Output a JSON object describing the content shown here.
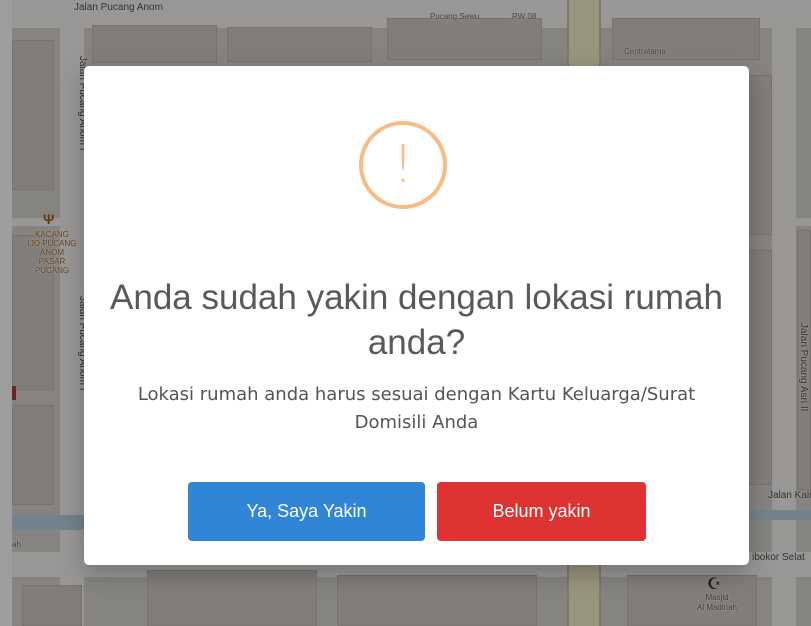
{
  "map": {
    "labels": {
      "jalan_pucang_anom_top": "Jalan Pucang Anom",
      "jalan_pucang_anom_i_upper": "Jalan Pucang Anom I",
      "jalan_pucang_anom_i_lower": "Jalan Pucang Anom I",
      "pucang_sewu": "Pucang Sewu",
      "rw08": "RW 08",
      "centratama": "Centratama",
      "jalan_pucang_asri_ii": "Jalan Pucang Asri II",
      "jalan_kali": "Jalan Kalib",
      "bokor_selat": "ibokor Selat",
      "masjid": "Masjid",
      "al_madinah": "Al Madinah",
      "kacang": "KACANG",
      "ijo_pucang": "IJO PUCANG",
      "anom": "ANOM",
      "pasar": "PASAR",
      "pucang": "PUCANG",
      "ah": "ah"
    },
    "icons": {
      "restaurant": "fork-knife-icon",
      "mosque": "mosque-icon"
    },
    "colors": {
      "background": "#d9d6d1",
      "block": "#cfcac5",
      "road": "#f5f4f2",
      "major_road": "#f6f1c8",
      "water": "#b7d4e2"
    }
  },
  "dialog": {
    "icon": "warning-exclamation-icon",
    "icon_glyph": "!",
    "title": "Anda sudah yakin dengan lokasi rumah anda?",
    "message": "Lokasi rumah anda harus sesuai dengan Kartu Keluarga/Surat Domisili Anda",
    "confirm_label": "Ya, Saya Yakin",
    "cancel_label": "Belum yakin",
    "colors": {
      "icon": "#f8bb86",
      "confirm": "#3085d6",
      "cancel": "#dd3333",
      "title": "#595959",
      "text": "#545454"
    }
  }
}
